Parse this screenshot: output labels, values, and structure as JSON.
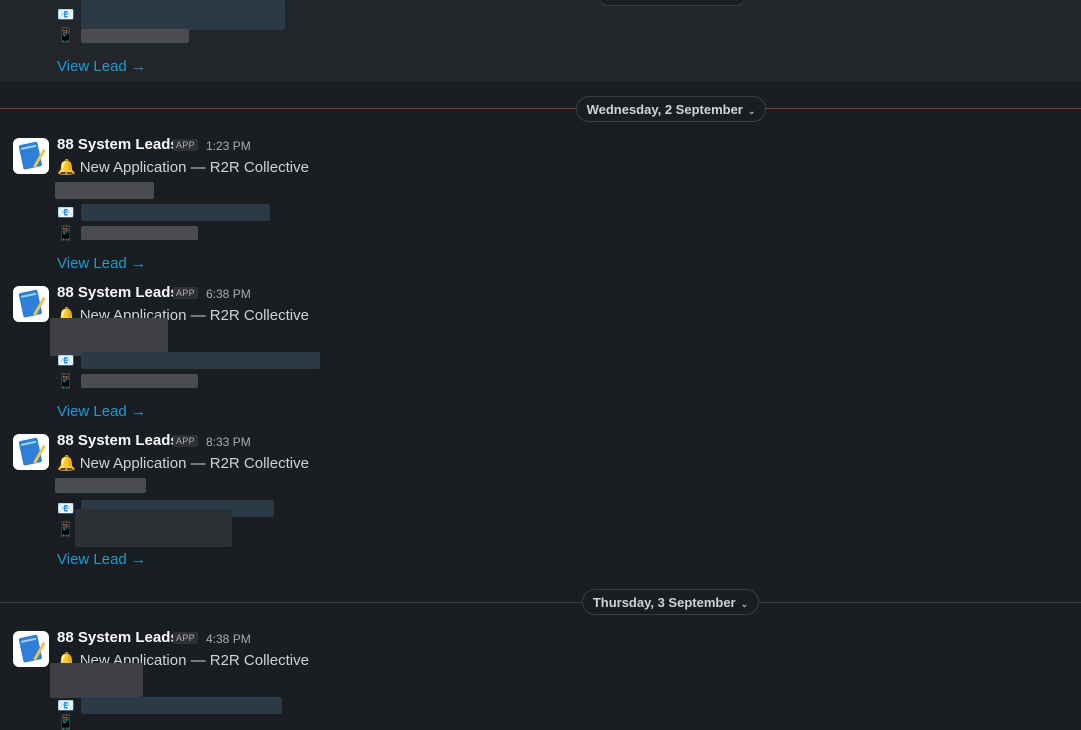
{
  "top_section": {
    "email_icon": "📧",
    "phone_icon": "📱",
    "view_lead": "View Lead →"
  },
  "date_dividers": [
    {
      "label": "Wednesday, 2 September",
      "chevron": "⌄"
    },
    {
      "label": "Thursday, 3 September",
      "chevron": "⌄"
    }
  ],
  "messages": [
    {
      "sender": "88 System Leads",
      "badge": "APP",
      "time": "1:23 PM",
      "bell": "🔔",
      "title": "New Application — R2R Collective",
      "email_icon": "📧",
      "phone_icon": "📱",
      "view_lead": "View Lead →"
    },
    {
      "sender": "88 System Leads",
      "badge": "APP",
      "time": "6:38 PM",
      "bell": "🔔",
      "title": "New Application — R2R Collective",
      "email_icon": "📧",
      "phone_icon": "📱",
      "view_lead": "View Lead →"
    },
    {
      "sender": "88 System Leads",
      "badge": "APP",
      "time": "8:33 PM",
      "bell": "🔔",
      "title": "New Application — R2R Collective",
      "email_icon": "📧",
      "phone_icon": "📱",
      "view_lead": "View Lead →"
    },
    {
      "sender": "88 System Leads",
      "badge": "APP",
      "time": "4:38 PM",
      "bell": "🔔",
      "title": "New Application — R2R Collective",
      "email_icon": "📧",
      "phone_icon": "📱"
    }
  ],
  "colors": {
    "background": "#1a1d21",
    "link": "#1d9bd1",
    "divider_new": "#8b3a2f",
    "divider": "#3a3d42"
  }
}
